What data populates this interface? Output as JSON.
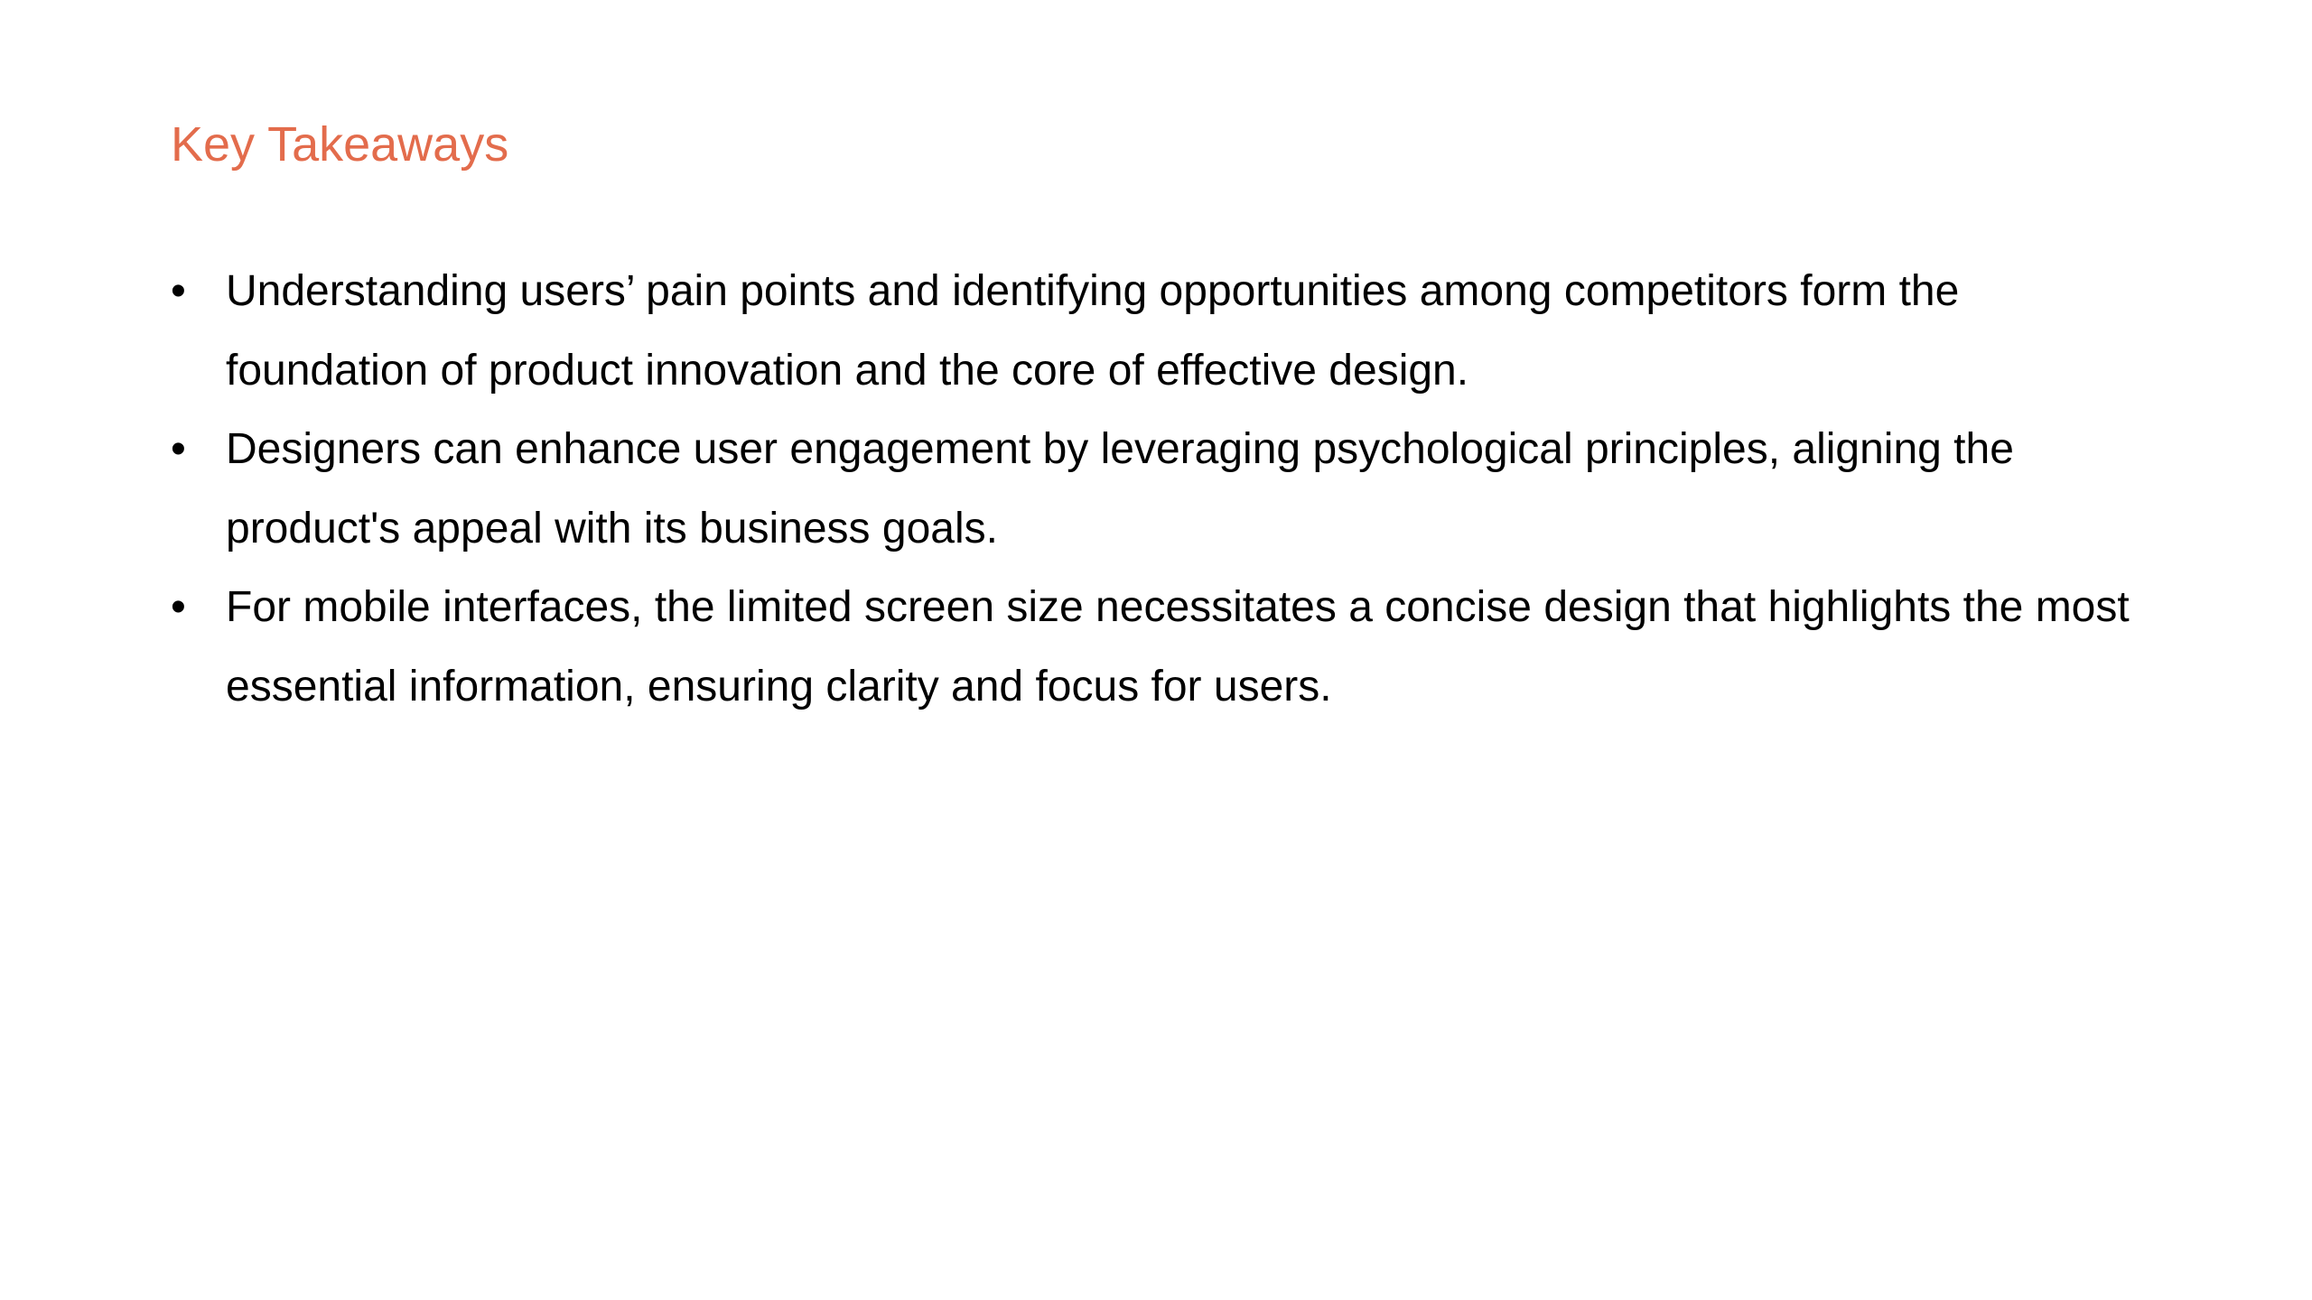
{
  "slide": {
    "title": "Key Takeaways",
    "bullets": [
      {
        "line1": "Understanding users’ pain points and identifying opportunities among competitors form the",
        "line2": "foundation of product innovation and the core of effective design."
      },
      {
        "line1": "Designers can enhance user engagement by leveraging psychological principles, aligning the",
        "line2": "product's appeal with its business goals."
      },
      {
        "line1": "For mobile interfaces, the limited screen size necessitates a concise design that highlights the most",
        "line2": "essential information, ensuring clarity and focus for users."
      }
    ],
    "bullet_glyph": "•",
    "title_color": "#e36c4c",
    "text_color": "#000000"
  }
}
